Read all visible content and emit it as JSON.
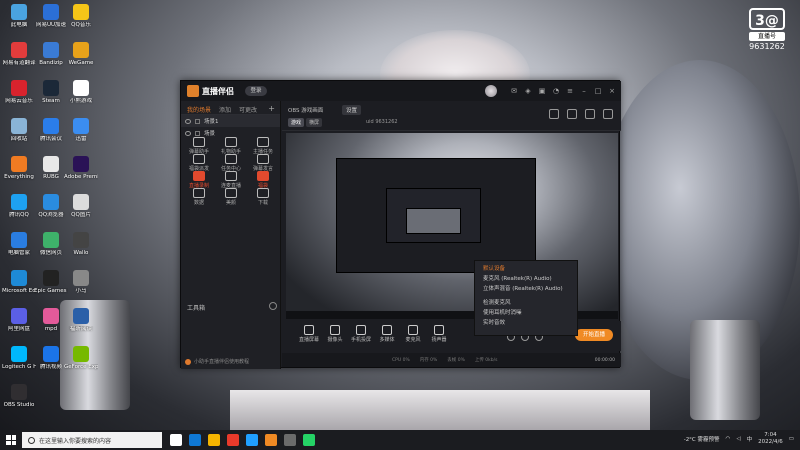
{
  "desktop": {
    "icons": [
      {
        "label": "此电脑",
        "color": "#4aa3e0"
      },
      {
        "label": "网易UU加速",
        "color": "#2b6fd6"
      },
      {
        "label": "QQ音乐",
        "color": "#f5c518"
      },
      {
        "label": "网易有道翻译",
        "color": "#e23c3c"
      },
      {
        "label": "Bandizip",
        "color": "#3a7bd5"
      },
      {
        "label": "WeGame",
        "color": "#e8a21a"
      },
      {
        "label": "网易云音乐",
        "color": "#d9232d"
      },
      {
        "label": "Steam",
        "color": "#1b2838"
      },
      {
        "label": "小熊游戏",
        "color": "#ffffff"
      },
      {
        "label": "回收站",
        "color": "#8ab4d6"
      },
      {
        "label": "腾讯会议",
        "color": "#2b7de9"
      },
      {
        "label": "迅雷",
        "color": "#3b8df0"
      },
      {
        "label": "Everything",
        "color": "#f07b22"
      },
      {
        "label": "RUBG",
        "color": "#e8e8e8"
      },
      {
        "label": "Adobe Premie...",
        "color": "#2a1256"
      },
      {
        "label": "腾讯QQ",
        "color": "#1ea1f1"
      },
      {
        "label": "QQ浏览器",
        "color": "#2a8ce0"
      },
      {
        "label": "QQ图片",
        "color": "#dcdcdc"
      },
      {
        "label": "电脑管家",
        "color": "#2a7de1"
      },
      {
        "label": "微信网页",
        "color": "#3eb16a"
      },
      {
        "label": "Wallo",
        "color": "#444"
      },
      {
        "label": "Microsoft Edge",
        "color": "#1e8ad6"
      },
      {
        "label": "Epic Games Launcher",
        "color": "#222"
      },
      {
        "label": "小马",
        "color": "#888"
      },
      {
        "label": "阿里网盘",
        "color": "#5b5fe6"
      },
      {
        "label": "mpd",
        "color": "#e35a9a"
      },
      {
        "label": "福昕阅读",
        "color": "#2a5fa8"
      },
      {
        "label": "Logitech G HUB",
        "color": "#00b8fc"
      },
      {
        "label": "腾讯视频",
        "color": "#1b74e8"
      },
      {
        "label": "GeForce Experience",
        "color": "#76b900"
      },
      {
        "label": "OBS Studio",
        "color": "#302e31"
      }
    ]
  },
  "watermark": {
    "logo": "3@",
    "badge": "直播号",
    "number": "9631262"
  },
  "app": {
    "name": "直播伴侣",
    "login": "登录",
    "left_tabs": [
      "我的场景",
      "添加",
      "可更改"
    ],
    "scenes": [
      "场景1",
      "场景"
    ],
    "tools_header": "工具箱",
    "tools": [
      {
        "label": "弹幕助手"
      },
      {
        "label": "礼物助手"
      },
      {
        "label": "主播任务"
      },
      {
        "label": "福袋派发"
      },
      {
        "label": "任务中心"
      },
      {
        "label": "弹幕发言"
      },
      {
        "label": "直播录制",
        "hot": true
      },
      {
        "label": "连麦直播"
      },
      {
        "label": "福袋",
        "hot": true
      },
      {
        "label": "数据"
      },
      {
        "label": "美颜"
      },
      {
        "label": "下载"
      }
    ],
    "left_footer": "小助手直播伴侣使用教程",
    "topbar": {
      "resolution": "OBS 游戏画面",
      "settings": "设置",
      "modes": [
        "游戏",
        "横屏"
      ],
      "uid": "uid 9631262"
    },
    "context_menu": [
      {
        "label": "默认设备",
        "on": true
      },
      {
        "label": "麦克风 (Realtek(R) Audio)"
      },
      {
        "label": "立体声混音 (Realtek(R) Audio)"
      },
      {
        "sep": true
      },
      {
        "label": "检测麦克风"
      },
      {
        "label": "使用耳机时消噪"
      },
      {
        "label": "实时音效"
      }
    ],
    "bottom_tools": [
      {
        "label": "直播屏幕"
      },
      {
        "label": "摄像头"
      },
      {
        "label": "手机投屏"
      },
      {
        "label": "多媒体"
      },
      {
        "label": "麦克风"
      },
      {
        "label": "扬声器"
      }
    ],
    "go_live": "开始直播",
    "status": [
      "CPU 0%",
      "内存 0%",
      "丢帧 0%",
      "上传 0kb/s"
    ],
    "clock": "00:00:00"
  },
  "taskbar": {
    "search_placeholder": "在这里输入你要搜索的内容",
    "apps": [
      "#ffffff",
      "#0f78d4",
      "#f4b400",
      "#e83a2b",
      "#20a0ff",
      "#f08a24",
      "#6b6b6b",
      "#25d366"
    ],
    "weather": "-2°C 雾霾预警",
    "time": "7:04",
    "date": "2022/4/6"
  },
  "colors": {
    "accent": "#f08a24",
    "hot": "#e24a2e"
  }
}
